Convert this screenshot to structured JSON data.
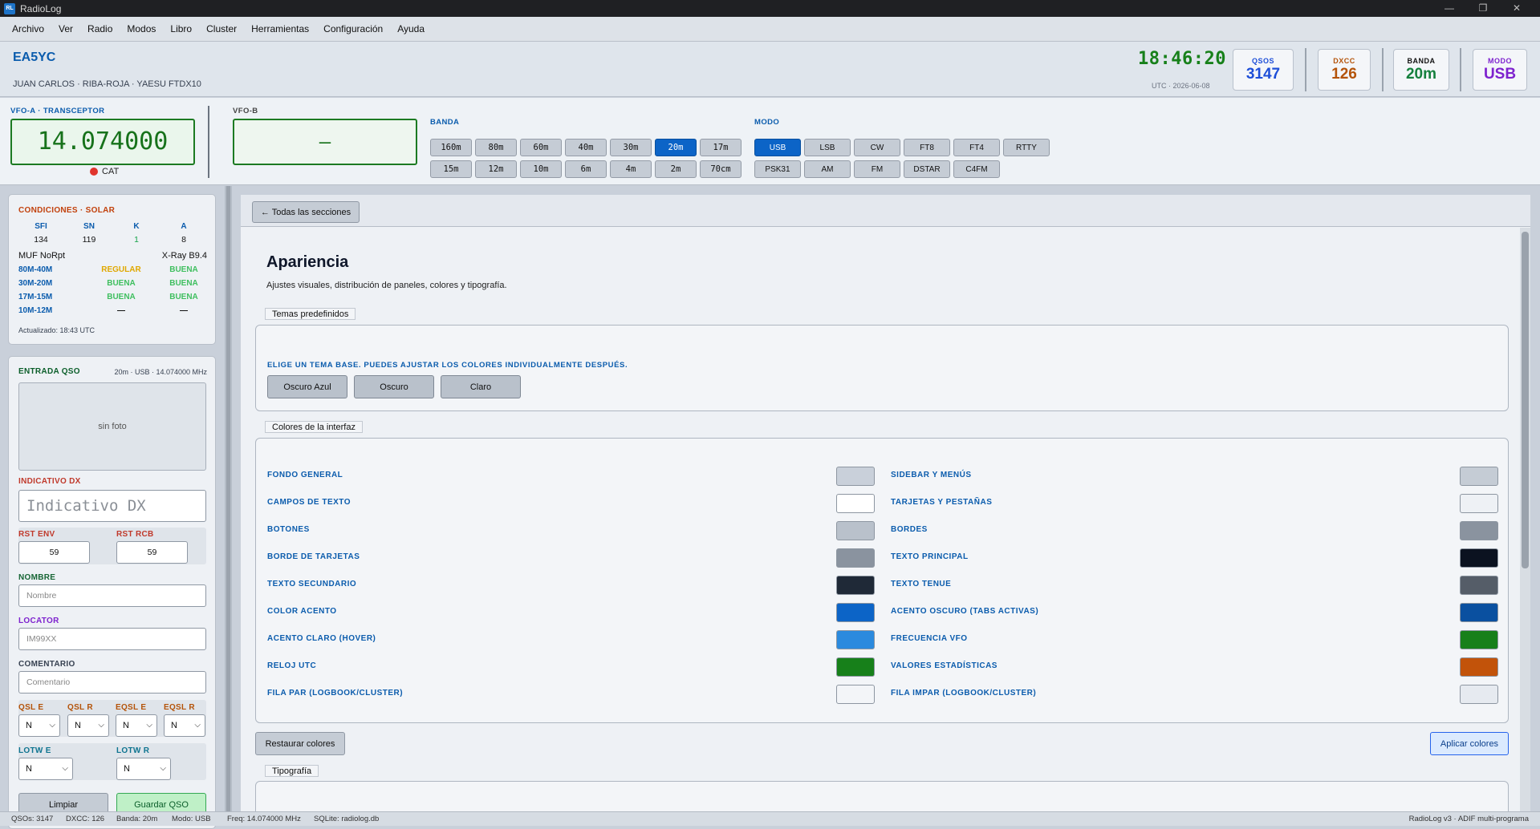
{
  "window": {
    "title": "RadioLog",
    "icon_text": "RL",
    "minimize": "—",
    "maximize": "❐",
    "close": "✕"
  },
  "menu": [
    "Archivo",
    "Ver",
    "Radio",
    "Modos",
    "Libro",
    "Cluster",
    "Herramientas",
    "Configuración",
    "Ayuda"
  ],
  "header": {
    "callsign": "EA5YC",
    "operator_info": "JUAN CARLOS · RIBA-ROJA · YAESU FTDX10",
    "clock": "18:46:20",
    "clock_sub": "UTC · 2026-06-08",
    "stats": [
      {
        "label": "QSOS",
        "value": "3147",
        "color": "#1d4ed8"
      },
      {
        "label": "DXCC",
        "value": "126",
        "color": "#b45309"
      },
      {
        "label": "BANDA",
        "value": "20m",
        "color": "#15803d"
      },
      {
        "label": "MODO",
        "value": "USB",
        "color": "#7e22ce"
      }
    ]
  },
  "vfo": {
    "a_label": "VFO-A · TRANSCEPTOR",
    "a_freq": "14.074000",
    "cat_label": "CAT",
    "b_label": "VFO-B",
    "b_freq": "—",
    "band_label": "BANDA",
    "mode_label": "MODO",
    "bands_row1": [
      "160m",
      "80m",
      "60m",
      "40m",
      "30m",
      "20m",
      "17m"
    ],
    "bands_row2": [
      "15m",
      "12m",
      "10m",
      "6m",
      "4m",
      "2m",
      "70cm"
    ],
    "active_band": "20m",
    "modes_row1": [
      "USB",
      "LSB",
      "CW",
      "FT8",
      "FT4",
      "RTTY"
    ],
    "modes_row2": [
      "PSK31",
      "AM",
      "FM",
      "DSTAR",
      "C4FM"
    ],
    "active_mode": "USB"
  },
  "solar": {
    "title": "CONDICIONES · SOLAR",
    "headers": [
      "SFI",
      "SN",
      "K",
      "A"
    ],
    "values": [
      "134",
      "119",
      "1",
      "8"
    ],
    "muf": "MUF NoRpt",
    "xray": "X-Ray B9.4",
    "bands": [
      {
        "band": "80M-40M",
        "day": "REGULAR",
        "night": "BUENA"
      },
      {
        "band": "30M-20M",
        "day": "BUENA",
        "night": "BUENA"
      },
      {
        "band": "17M-15M",
        "day": "BUENA",
        "night": "BUENA"
      },
      {
        "band": "10M-12M",
        "day": "—",
        "night": "—"
      }
    ],
    "updated": "Actualizado: 18:43 UTC"
  },
  "qso": {
    "title": "ENTRADA QSO",
    "info": "20m · USB · 14.074000 MHz",
    "photo": "sin foto",
    "dx_label": "INDICATIVO DX",
    "dx_placeholder": "Indicativo DX",
    "rst_env_label": "RST ENV",
    "rst_env": "59",
    "rst_rcb_label": "RST RCB",
    "rst_rcb": "59",
    "name_label": "NOMBRE",
    "name_placeholder": "Nombre",
    "locator_label": "LOCATOR",
    "locator_placeholder": "IM99XX",
    "comment_label": "COMENTARIO",
    "comment_placeholder": "Comentario",
    "qsl_labels": [
      "QSL E",
      "QSL R",
      "EQSL E",
      "EQSL R"
    ],
    "qsl_values": [
      "N",
      "N",
      "N",
      "N"
    ],
    "lotw_labels": [
      "LOTW E",
      "LOTW R"
    ],
    "lotw_values": [
      "N",
      "N"
    ],
    "clear_button": "Limpiar",
    "save_button": "Guardar QSO"
  },
  "settings": {
    "back_button": "← Todas las secciones",
    "title": "Apariencia",
    "subtitle": "Ajustes visuales, distribución de paneles, colores y tipografía.",
    "themes_group": "Temas predefinidos",
    "themes_hint": "ELIGE UN TEMA BASE. PUEDES AJUSTAR LOS COLORES INDIVIDUALMENTE DESPUÉS.",
    "themes": [
      "Oscuro Azul",
      "Oscuro",
      "Claro"
    ],
    "colors_group": "Colores de la interfaz",
    "colors_left": [
      {
        "label": "FONDO GENERAL",
        "color": "#c9d0da"
      },
      {
        "label": "CAMPOS DE TEXTO",
        "color": "#ffffff"
      },
      {
        "label": "BOTONES",
        "color": "#b9c1cb"
      },
      {
        "label": "BORDE DE TARJETAS",
        "color": "#8a939f"
      },
      {
        "label": "TEXTO SECUNDARIO",
        "color": "#1f2937"
      },
      {
        "label": "COLOR ACENTO",
        "color": "#0c64c7"
      },
      {
        "label": "ACENTO CLARO (HOVER)",
        "color": "#2b8ade"
      },
      {
        "label": "RELOJ UTC",
        "color": "#17801a"
      },
      {
        "label": "FILA PAR (LOGBOOK/CLUSTER)",
        "color": "#f3f5f8"
      }
    ],
    "colors_right": [
      {
        "label": "SIDEBAR Y MENÚS",
        "color": "#c5ccd5"
      },
      {
        "label": "TARJETAS Y PESTAÑAS",
        "color": "#eef1f5"
      },
      {
        "label": "BORDES",
        "color": "#8a939f"
      },
      {
        "label": "TEXTO PRINCIPAL",
        "color": "#0b1220"
      },
      {
        "label": "TEXTO TENUE",
        "color": "#555d68"
      },
      {
        "label": "ACENTO OSCURO (TABS ACTIVAS)",
        "color": "#0a50a0"
      },
      {
        "label": "FRECUENCIA VFO",
        "color": "#17801a"
      },
      {
        "label": "VALORES ESTADÍSTICAS",
        "color": "#c2530a"
      },
      {
        "label": "FILA IMPAR (LOGBOOK/CLUSTER)",
        "color": "#e6eaf0"
      }
    ],
    "restore_button": "Restaurar colores",
    "apply_button": "Aplicar colores",
    "typography_group": "Tipografía"
  },
  "statusbar": {
    "qsos": "QSOs: 3147",
    "dxcc": "DXCC: 126",
    "band": "Banda: 20m",
    "mode": "Modo: USB",
    "freq": "Freq: 14.074000 MHz",
    "db": "SQLite: radiolog.db",
    "right": "RadioLog v3 · ADIF multi-programa"
  }
}
